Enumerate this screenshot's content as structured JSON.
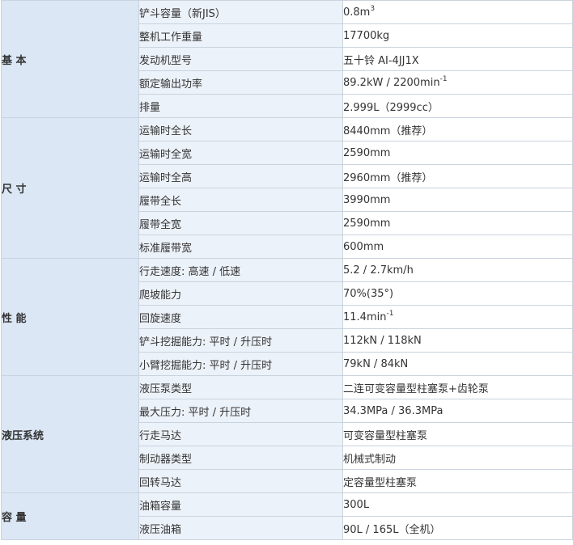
{
  "sections": [
    {
      "category": "基 本",
      "rows": [
        {
          "label": "铲斗容量（新JIS）",
          "value": "0.8m",
          "sup": "3"
        },
        {
          "label": "整机工作重量",
          "value": "17700kg"
        },
        {
          "label": "发动机型号",
          "value": "五十铃 AI-4JJ1X"
        },
        {
          "label": "额定输出功率",
          "value": "89.2kW / 2200min",
          "sup": "-1"
        },
        {
          "label": "排量",
          "value": "2.999L（2999cc）"
        }
      ]
    },
    {
      "category": "尺 寸",
      "rows": [
        {
          "label": "运输时全长",
          "value": "8440mm（推荐）"
        },
        {
          "label": "运输时全宽",
          "value": "2590mm"
        },
        {
          "label": "运输时全高",
          "value": "2960mm（推荐）"
        },
        {
          "label": "履带全长",
          "value": "3990mm"
        },
        {
          "label": "履带全宽",
          "value": "2590mm"
        },
        {
          "label": "标准履带宽",
          "value": "600mm"
        }
      ]
    },
    {
      "category": "性 能",
      "rows": [
        {
          "label": "行走速度: 高速 / 低速",
          "value": "5.2 / 2.7km/h"
        },
        {
          "label": "爬坡能力",
          "value": "70%(35°)"
        },
        {
          "label": "回旋速度",
          "value": "11.4min",
          "sup": "-1"
        },
        {
          "label": "铲斗挖掘能力: 平时 / 升压时",
          "value": "112kN / 118kN"
        },
        {
          "label": "小臂挖掘能力: 平时 / 升压时",
          "value": "79kN / 84kN"
        }
      ]
    },
    {
      "category": "液压系统",
      "rows": [
        {
          "label": "液压泵类型",
          "value": "二连可变容量型柱塞泵+齿轮泵"
        },
        {
          "label": "最大压力: 平时 / 升压时",
          "value": "34.3MPa / 36.3MPa"
        },
        {
          "label": "行走马达",
          "value": "可变容量型柱塞泵"
        },
        {
          "label": "制动器类型",
          "value": "机械式制动"
        },
        {
          "label": "回转马达",
          "value": "定容量型柱塞泵"
        }
      ]
    },
    {
      "category": "容 量",
      "rows": [
        {
          "label": "油箱容量",
          "value": "300L"
        },
        {
          "label": "液压油箱",
          "value": "90L / 165L（全机）"
        }
      ]
    }
  ]
}
